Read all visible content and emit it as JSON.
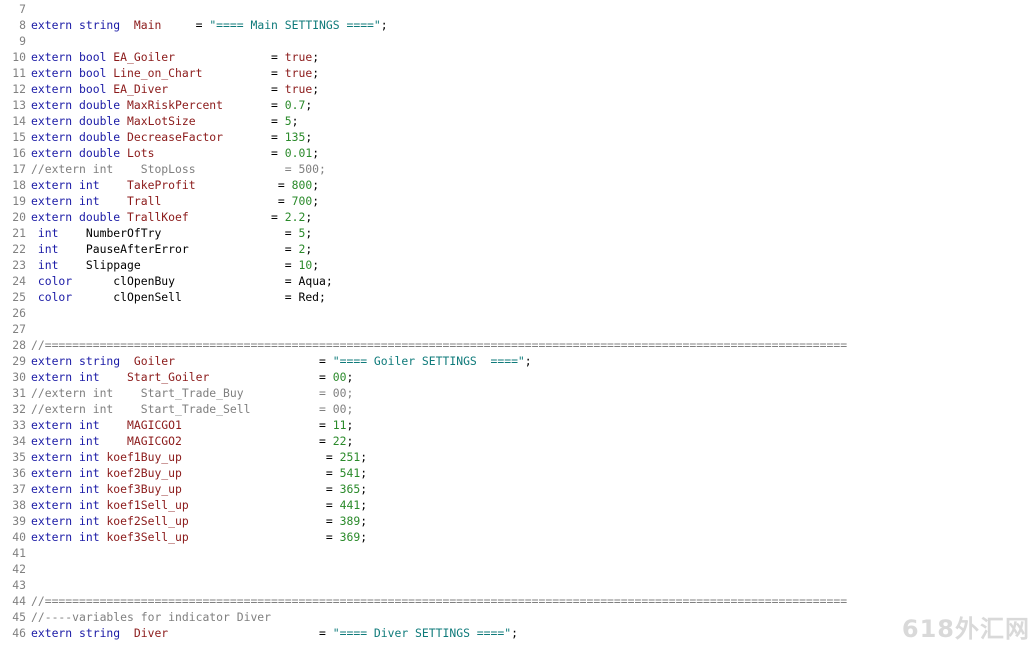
{
  "colors": {
    "keyword": "#1a1aa6",
    "identifier": "#8b1a1a",
    "string": "#0e7a7a",
    "number": "#2a8a2a",
    "comment": "#7f7f7f",
    "line_number": "#808080"
  },
  "watermark": "618外汇网",
  "lines": [
    {
      "n": "7",
      "t": [],
      "k": []
    },
    {
      "n": "8",
      "t": [
        "extern string ",
        " Main",
        "     = ",
        "\"==== Main SETTINGS ====\"",
        ";"
      ],
      "k": [
        "kw",
        "id",
        "pl",
        "str",
        "pl"
      ]
    },
    {
      "n": "9",
      "t": [],
      "k": []
    },
    {
      "n": "10",
      "t": [
        "extern bool ",
        "EA_Goiler",
        "              = ",
        "true",
        ";"
      ],
      "k": [
        "kw",
        "id",
        "pl",
        "id",
        "pl"
      ]
    },
    {
      "n": "11",
      "t": [
        "extern bool ",
        "Line_on_Chart",
        "          = ",
        "true",
        ";"
      ],
      "k": [
        "kw",
        "id",
        "pl",
        "id",
        "pl"
      ]
    },
    {
      "n": "12",
      "t": [
        "extern bool ",
        "EA_Diver",
        "               = ",
        "true",
        ";"
      ],
      "k": [
        "kw",
        "id",
        "pl",
        "id",
        "pl"
      ]
    },
    {
      "n": "13",
      "t": [
        "extern double ",
        "MaxRiskPercent",
        "       = ",
        "0.7",
        ";"
      ],
      "k": [
        "kw",
        "id",
        "pl",
        "num",
        "pl"
      ]
    },
    {
      "n": "14",
      "t": [
        "extern double ",
        "MaxLotSize",
        "           = ",
        "5",
        ";"
      ],
      "k": [
        "kw",
        "id",
        "pl",
        "num",
        "pl"
      ]
    },
    {
      "n": "15",
      "t": [
        "extern double ",
        "DecreaseFactor",
        "       = ",
        "135",
        ";"
      ],
      "k": [
        "kw",
        "id",
        "pl",
        "num",
        "pl"
      ]
    },
    {
      "n": "16",
      "t": [
        "extern double ",
        "Lots",
        "                 = ",
        "0.01",
        ";"
      ],
      "k": [
        "kw",
        "id",
        "pl",
        "num",
        "pl"
      ]
    },
    {
      "n": "17",
      "t": [
        "//extern int    StopLoss             = 500;"
      ],
      "k": [
        "com"
      ]
    },
    {
      "n": "18",
      "t": [
        "extern int    ",
        "TakeProfit",
        "            = ",
        "800",
        ";"
      ],
      "k": [
        "kw",
        "id",
        "pl",
        "num",
        "pl"
      ]
    },
    {
      "n": "19",
      "t": [
        "extern int    ",
        "Trall",
        "                 = ",
        "700",
        ";"
      ],
      "k": [
        "kw",
        "id",
        "pl",
        "num",
        "pl"
      ]
    },
    {
      "n": "20",
      "t": [
        "extern double ",
        "TrallKoef",
        "            = ",
        "2.2",
        ";"
      ],
      "k": [
        "kw",
        "id",
        "pl",
        "num",
        "pl"
      ]
    },
    {
      "n": "21",
      "t": [
        " int    ",
        "NumberOfTry",
        "                  = ",
        "5",
        ";"
      ],
      "k": [
        "kw",
        "pl",
        "pl",
        "num",
        "pl"
      ]
    },
    {
      "n": "22",
      "t": [
        " int    ",
        "PauseAfterError",
        "              = ",
        "2",
        ";"
      ],
      "k": [
        "kw",
        "pl",
        "pl",
        "num",
        "pl"
      ]
    },
    {
      "n": "23",
      "t": [
        " int    ",
        "Slippage",
        "                     = ",
        "10",
        ";"
      ],
      "k": [
        "kw",
        "pl",
        "pl",
        "num",
        "pl"
      ]
    },
    {
      "n": "24",
      "t": [
        " color      ",
        "clOpenBuy",
        "                = ",
        "Aqua",
        ";"
      ],
      "k": [
        "kw",
        "pl",
        "pl",
        "pl",
        "pl"
      ]
    },
    {
      "n": "25",
      "t": [
        " color      ",
        "clOpenSell",
        "               = ",
        "Red",
        ";"
      ],
      "k": [
        "kw",
        "pl",
        "pl",
        "pl",
        "pl"
      ]
    },
    {
      "n": "26",
      "t": [],
      "k": []
    },
    {
      "n": "27",
      "t": [],
      "k": []
    },
    {
      "n": "28",
      "t": [
        "//====================================================================================================================="
      ],
      "k": [
        "com"
      ]
    },
    {
      "n": "29",
      "t": [
        "extern string ",
        " Goiler",
        "                     = ",
        "\"==== Goiler SETTINGS  ====\"",
        ";"
      ],
      "k": [
        "kw",
        "id",
        "pl",
        "str",
        "pl"
      ]
    },
    {
      "n": "30",
      "t": [
        "extern int    ",
        "Start_Goiler",
        "                = ",
        "00",
        ";"
      ],
      "k": [
        "kw",
        "id",
        "pl",
        "num",
        "pl"
      ]
    },
    {
      "n": "31",
      "t": [
        "//extern int    Start_Trade_Buy           = 00;"
      ],
      "k": [
        "com"
      ]
    },
    {
      "n": "32",
      "t": [
        "//extern int    Start_Trade_Sell          = 00;"
      ],
      "k": [
        "com"
      ]
    },
    {
      "n": "33",
      "t": [
        "extern int    ",
        "MAGICGO1",
        "                    = ",
        "11",
        ";"
      ],
      "k": [
        "kw",
        "id",
        "pl",
        "num",
        "pl"
      ]
    },
    {
      "n": "34",
      "t": [
        "extern int    ",
        "MAGICGO2",
        "                    = ",
        "22",
        ";"
      ],
      "k": [
        "kw",
        "id",
        "pl",
        "num",
        "pl"
      ]
    },
    {
      "n": "35",
      "t": [
        "extern int ",
        "koef1Buy_up",
        "                     = ",
        "251",
        ";"
      ],
      "k": [
        "kw",
        "id",
        "pl",
        "num",
        "pl"
      ]
    },
    {
      "n": "36",
      "t": [
        "extern int ",
        "koef2Buy_up",
        "                     = ",
        "541",
        ";"
      ],
      "k": [
        "kw",
        "id",
        "pl",
        "num",
        "pl"
      ]
    },
    {
      "n": "37",
      "t": [
        "extern int ",
        "koef3Buy_up",
        "                     = ",
        "365",
        ";"
      ],
      "k": [
        "kw",
        "id",
        "pl",
        "num",
        "pl"
      ]
    },
    {
      "n": "38",
      "t": [
        "extern int ",
        "koef1Sell_up",
        "                    = ",
        "441",
        ";"
      ],
      "k": [
        "kw",
        "id",
        "pl",
        "num",
        "pl"
      ]
    },
    {
      "n": "39",
      "t": [
        "extern int ",
        "koef2Sell_up",
        "                    = ",
        "389",
        ";"
      ],
      "k": [
        "kw",
        "id",
        "pl",
        "num",
        "pl"
      ]
    },
    {
      "n": "40",
      "t": [
        "extern int ",
        "koef3Sell_up",
        "                    = ",
        "369",
        ";"
      ],
      "k": [
        "kw",
        "id",
        "pl",
        "num",
        "pl"
      ]
    },
    {
      "n": "41",
      "t": [],
      "k": []
    },
    {
      "n": "42",
      "t": [],
      "k": []
    },
    {
      "n": "43",
      "t": [],
      "k": []
    },
    {
      "n": "44",
      "t": [
        "//====================================================================================================================="
      ],
      "k": [
        "com"
      ]
    },
    {
      "n": "45",
      "t": [
        "//----variables for indicator Diver"
      ],
      "k": [
        "com"
      ]
    },
    {
      "n": "46",
      "t": [
        "extern string ",
        " Diver",
        "                      = ",
        "\"==== Diver SETTINGS ====\"",
        ";"
      ],
      "k": [
        "kw",
        "id",
        "pl",
        "str",
        "pl"
      ]
    }
  ]
}
